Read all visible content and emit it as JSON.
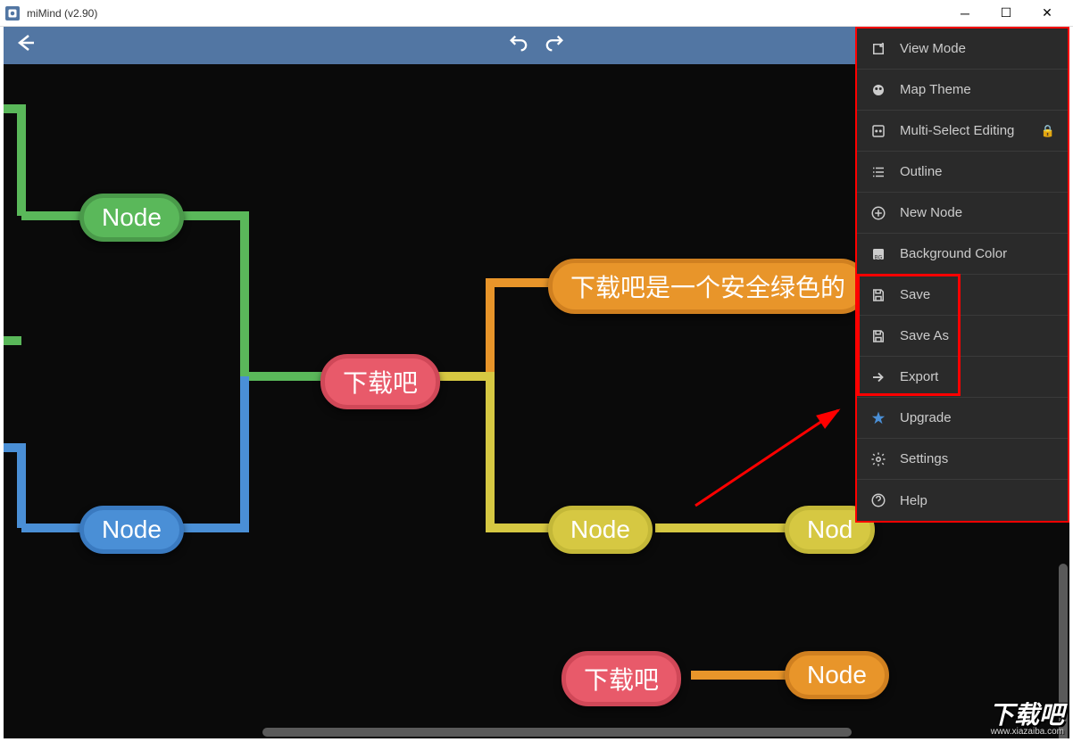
{
  "window": {
    "title": "miMind (v2.90)"
  },
  "toolbar": {
    "back": "←",
    "undo": "↶",
    "redo": "↷"
  },
  "nodes": {
    "n_green": "Node",
    "n_blue": "Node",
    "n_red1": "下载吧",
    "n_orange1": "下载吧是一个安全绿色的",
    "n_yellow": "Node",
    "n_yellow_child": "Nod",
    "n_red2": "下载吧",
    "n_orange2": "Node"
  },
  "menu": {
    "items": [
      {
        "label": "View Mode",
        "icon": "view"
      },
      {
        "label": "Map Theme",
        "icon": "theme"
      },
      {
        "label": "Multi-Select Editing",
        "icon": "multiselect",
        "locked": true
      },
      {
        "label": "Outline",
        "icon": "outline"
      },
      {
        "label": "New Node",
        "icon": "newnode"
      },
      {
        "label": "Background Color",
        "icon": "bgcolor"
      },
      {
        "label": "Save",
        "icon": "save"
      },
      {
        "label": "Save As",
        "icon": "save"
      },
      {
        "label": "Export",
        "icon": "export"
      },
      {
        "label": "Upgrade",
        "icon": "star"
      },
      {
        "label": "Settings",
        "icon": "settings"
      },
      {
        "label": "Help",
        "icon": "help"
      }
    ]
  },
  "watermark": {
    "big": "下载吧",
    "small": "www.xiazaiba.com"
  }
}
